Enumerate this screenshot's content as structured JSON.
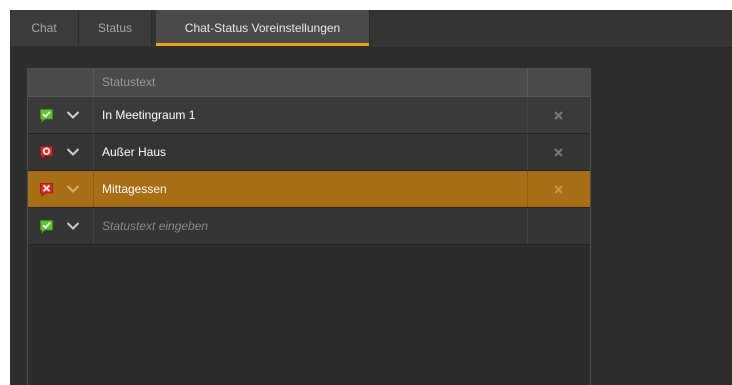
{
  "tabs": [
    {
      "label": "Chat",
      "active": false
    },
    {
      "label": "Status",
      "active": false
    },
    {
      "label": "Chat-Status Voreinstellungen",
      "active": true
    }
  ],
  "grid": {
    "header": {
      "icon_col": "",
      "text_col": "Statustext",
      "delete_col": ""
    },
    "rows": [
      {
        "status_icon": "green-check-bubble-icon",
        "text": "In Meetingraum 1",
        "deletable": true,
        "selected": false
      },
      {
        "status_icon": "red-circle-bubble-icon",
        "text": "Außer Haus",
        "deletable": true,
        "selected": false
      },
      {
        "status_icon": "red-x-bubble-icon",
        "text": "Mittagessen",
        "deletable": true,
        "selected": true
      }
    ],
    "new_row": {
      "status_icon": "green-check-bubble-icon",
      "placeholder": "Statustext eingeben"
    }
  },
  "colors": {
    "accent": "#f0a10c",
    "selected_row": "#a76e14",
    "status_green": "#5cc52a",
    "status_red": "#e0262a"
  }
}
